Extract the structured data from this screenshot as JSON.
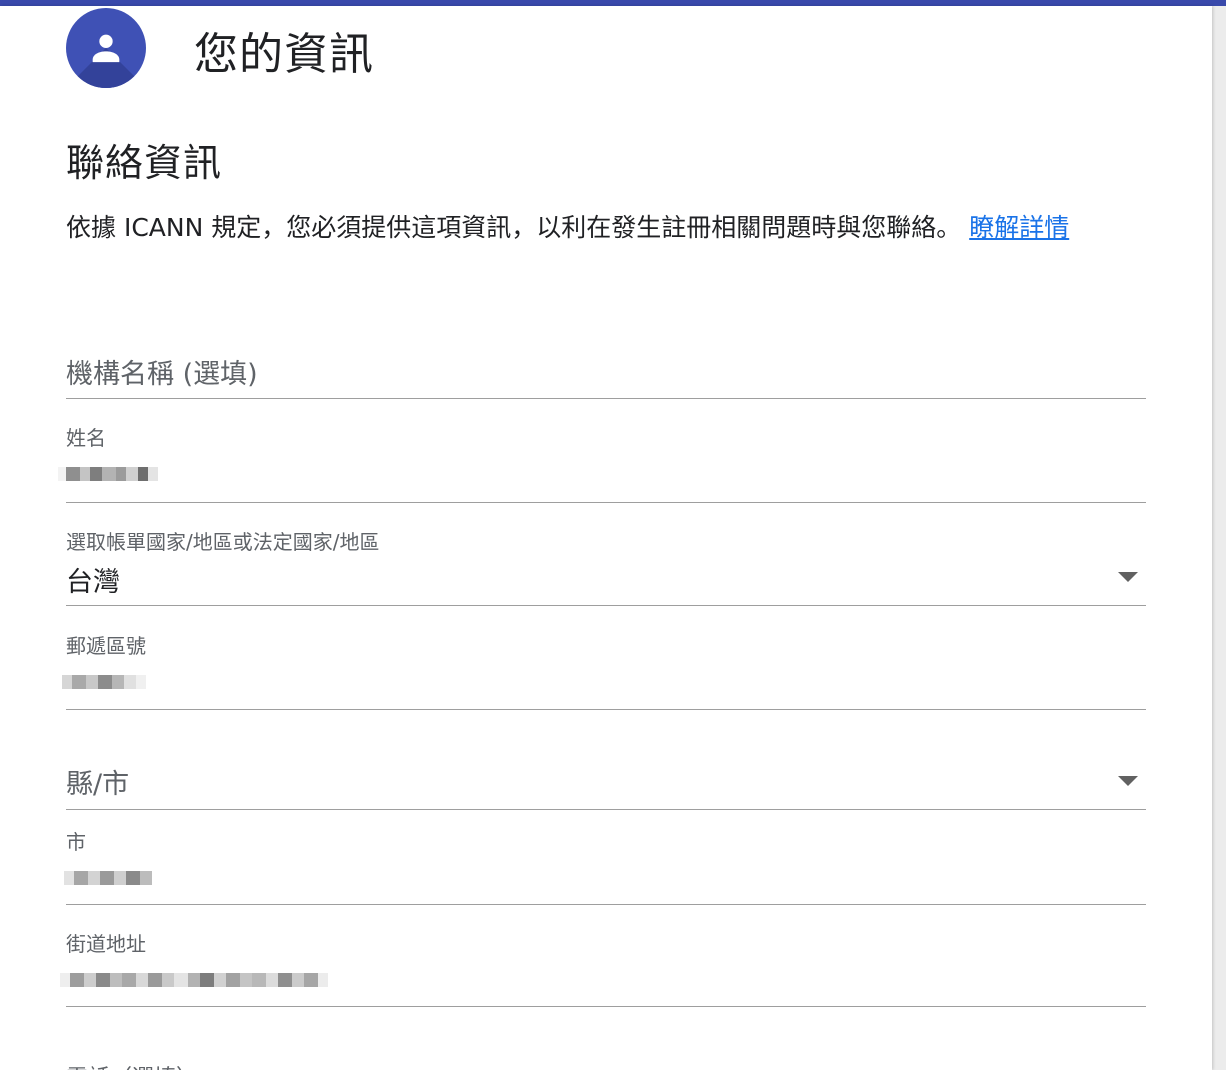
{
  "header": {
    "title": "您的資訊",
    "avatar_icon": "person-icon",
    "accent_color": "#3f51b5",
    "bar_color": "#3949ab"
  },
  "section": {
    "title": "聯絡資訊",
    "description": "依據 ICANN 規定，您必須提供這項資訊，以利在發生註冊相關問題時與您聯絡。",
    "learn_more": "瞭解詳情",
    "link_color": "#1a73e8"
  },
  "form": {
    "organization": {
      "placeholder": "機構名稱 (選填)"
    },
    "name": {
      "label": "姓名"
    },
    "country": {
      "label": "選取帳單國家/地區或法定國家/地區",
      "value": "台灣"
    },
    "postal_code": {
      "label": "郵遞區號"
    },
    "county": {
      "placeholder": "縣/市"
    },
    "city": {
      "label": "市"
    },
    "street": {
      "label": "街道地址"
    },
    "next_label": "電話（選填）"
  }
}
